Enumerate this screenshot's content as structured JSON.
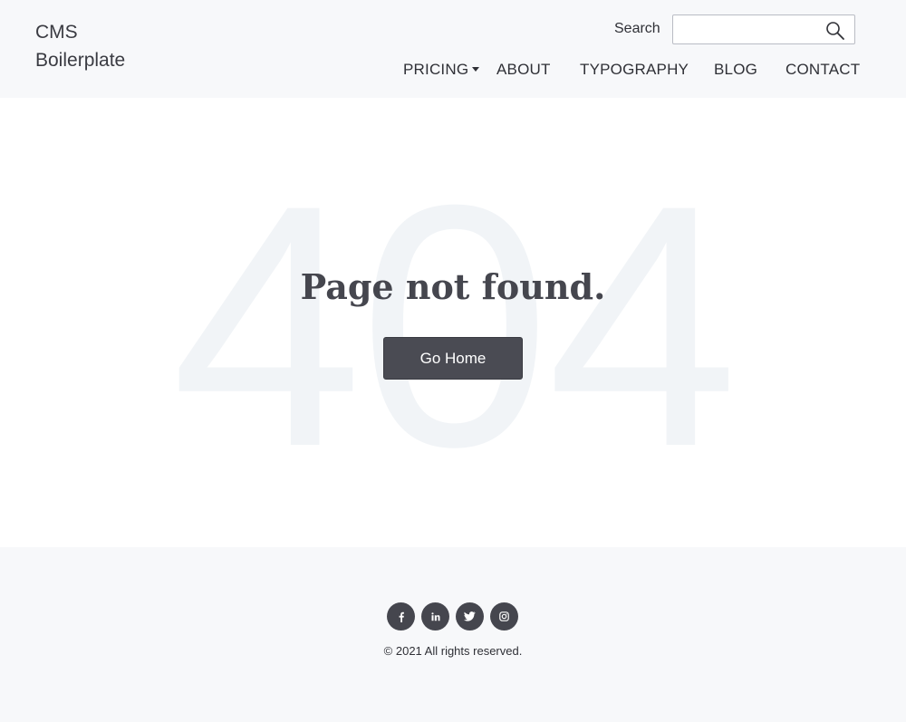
{
  "header": {
    "logo_text": "CMS Boilerplate",
    "search": {
      "label": "Search",
      "value": "",
      "placeholder": "",
      "icon": "search-icon"
    },
    "nav": [
      {
        "label": "PRICING",
        "has_dropdown": true
      },
      {
        "label": "ABOUT"
      },
      {
        "label": "TYPOGRAPHY"
      },
      {
        "label": "BLOG"
      },
      {
        "label": "CONTACT"
      }
    ]
  },
  "main": {
    "background_text": "404",
    "title": "Page not found.",
    "button_label": "Go Home"
  },
  "footer": {
    "social": [
      {
        "icon": "facebook-icon"
      },
      {
        "icon": "linkedin-icon"
      },
      {
        "icon": "twitter-icon"
      },
      {
        "icon": "instagram-icon"
      }
    ],
    "copyright": "© 2021 All rights reserved."
  },
  "colors": {
    "header_bg": "#f7f8fa",
    "text": "#2f3036",
    "button_bg": "#4a4b53",
    "watermark": "#f1f4f7"
  }
}
